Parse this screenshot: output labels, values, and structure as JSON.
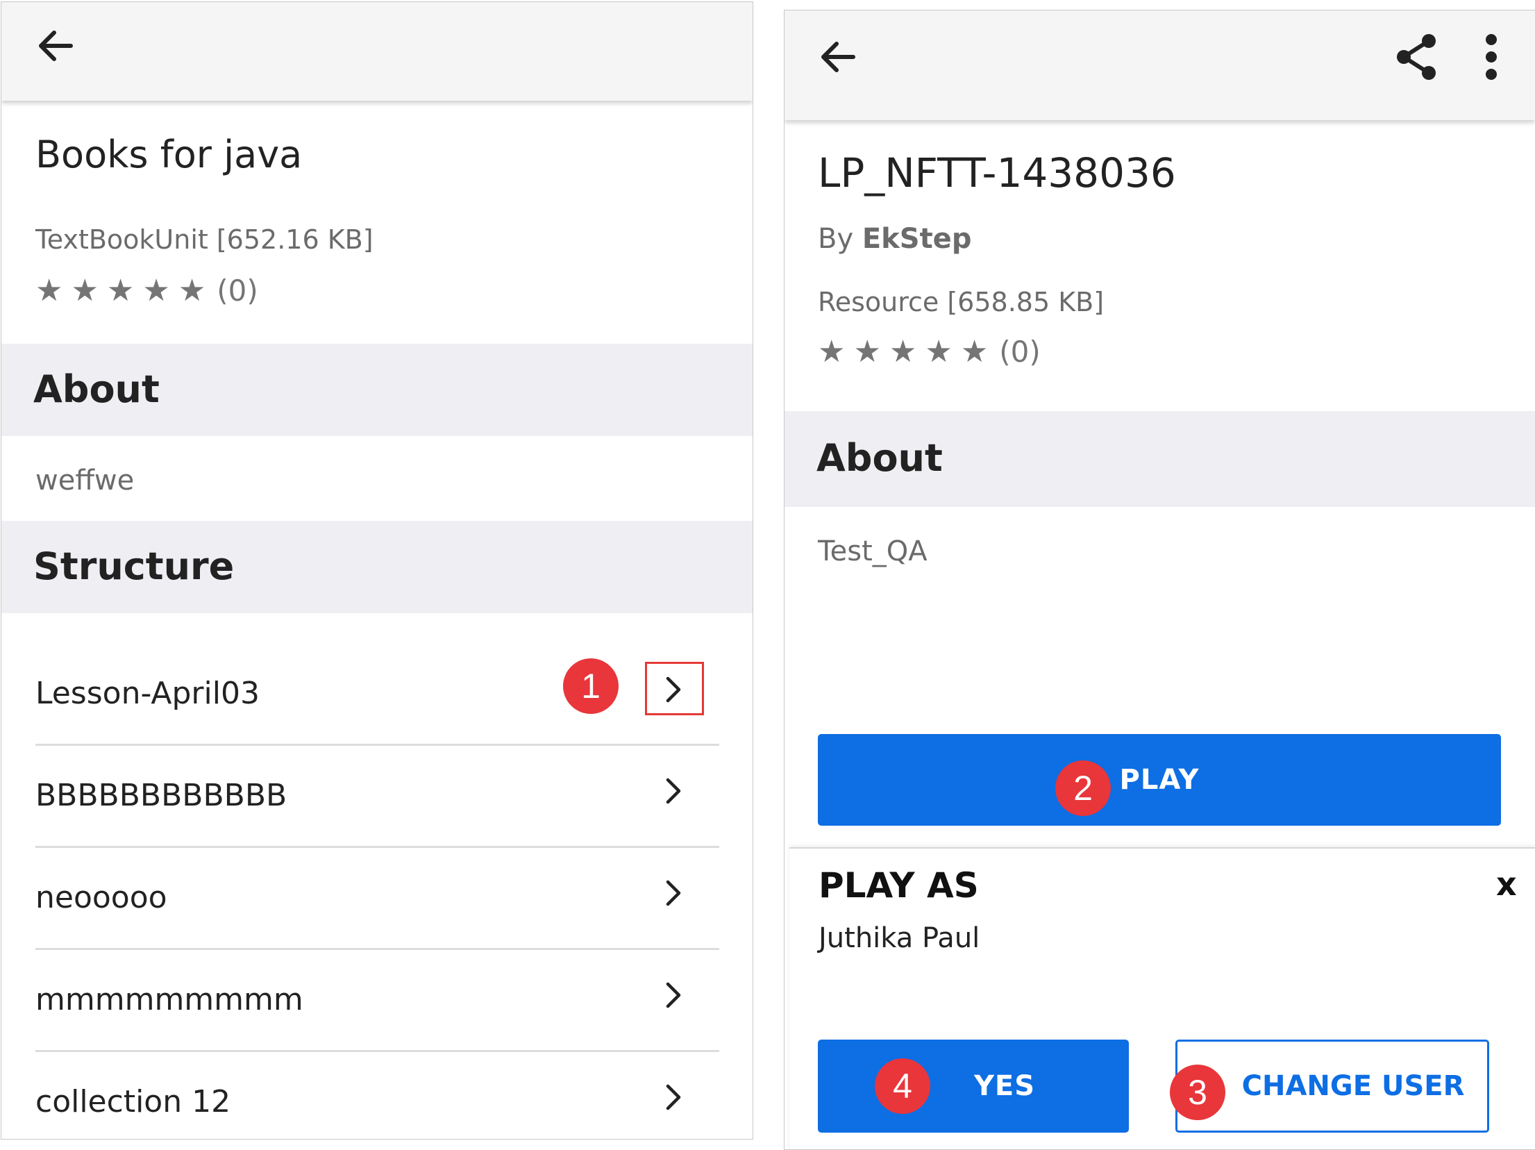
{
  "left": {
    "title": "Books for java",
    "meta": "TextBookUnit [652.16 KB]",
    "rating": {
      "stars_filled": 0,
      "stars_total": 5,
      "count": "(0)"
    },
    "about_heading": "About",
    "about_text": "weffwe",
    "structure_heading": "Structure",
    "structure_items": [
      {
        "label": "Lesson-April03"
      },
      {
        "label": "BBBBBBBBBBBB"
      },
      {
        "label": "neooooo"
      },
      {
        "label": "mmmmmmmmm"
      },
      {
        "label": "collection 12"
      }
    ],
    "highlight_marker": "1"
  },
  "right": {
    "title": "LP_NFTT-1438036",
    "by_prefix": "By ",
    "author": "EkStep",
    "meta": "Resource [658.85 KB]",
    "rating": {
      "stars_filled": 0,
      "stars_total": 5,
      "count": "(0)"
    },
    "about_heading": "About",
    "about_text": "Test_QA",
    "play_label": "PLAY",
    "play_marker": "2",
    "sheet": {
      "heading": "PLAY AS",
      "user_name": "Juthika Paul",
      "close_label": "x",
      "yes_label": "YES",
      "yes_marker": "4",
      "change_user_label": "CHANGE USER",
      "change_user_marker": "3"
    }
  },
  "colors": {
    "accent": "#0e6ee3",
    "marker": "#e8363b",
    "section_bg": "#efeff3",
    "appbar_bg": "#f5f5f5",
    "highlight_box": "#e53935"
  },
  "icons": [
    "back-arrow-icon",
    "share-icon",
    "more-vert-icon",
    "star-icon",
    "chevron-right-icon",
    "close-icon"
  ]
}
